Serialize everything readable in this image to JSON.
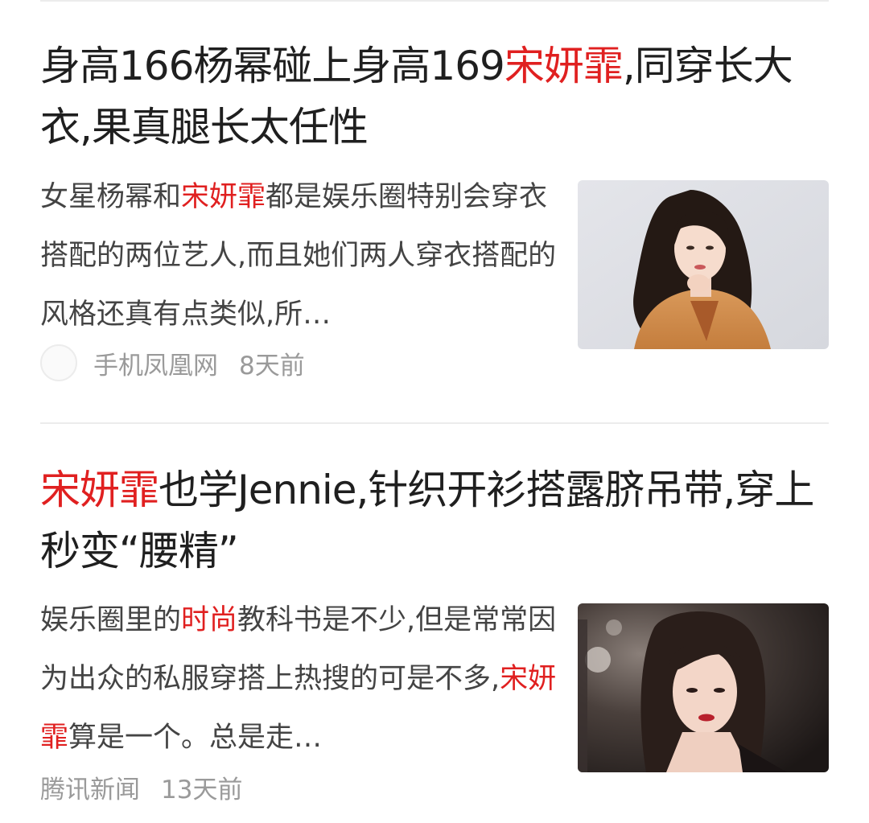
{
  "articles": [
    {
      "title_parts": [
        {
          "text": "身高166杨幂碰上身高169",
          "highlight": false
        },
        {
          "text": "宋妍霏",
          "highlight": true
        },
        {
          "text": ",同穿长大衣,果真腿长太任性",
          "highlight": false
        }
      ],
      "summary_parts": [
        {
          "text": "女星杨幂和",
          "highlight": false
        },
        {
          "text": "宋妍霏",
          "highlight": true
        },
        {
          "text": "都是娱乐圈特别会穿衣搭配的两位艺人,而且她们两人穿衣搭配的风格还真有点类似,所…",
          "highlight": false
        }
      ],
      "source": "手机凤凰网",
      "time": "8天前",
      "has_source_avatar": true
    },
    {
      "title_parts": [
        {
          "text": "宋妍霏",
          "highlight": true
        },
        {
          "text": "也学Jennie,针织开衫搭露脐吊带,穿上秒变“腰精”",
          "highlight": false
        }
      ],
      "summary_parts": [
        {
          "text": "娱乐圈里的",
          "highlight": false
        },
        {
          "text": "时尚",
          "highlight": true
        },
        {
          "text": "教科书是不少,但是常常因为出众的私服穿搭上热搜的可是不多,",
          "highlight": false
        },
        {
          "text": "宋妍霏",
          "highlight": true
        },
        {
          "text": "算是一个。总是走…",
          "highlight": false
        }
      ],
      "source": "腾讯新闻",
      "time": "13天前",
      "has_source_avatar": false
    }
  ],
  "colors": {
    "highlight": "#e02020",
    "title": "#1f1f1f",
    "summary": "#444444",
    "meta": "#9a9a9a"
  }
}
